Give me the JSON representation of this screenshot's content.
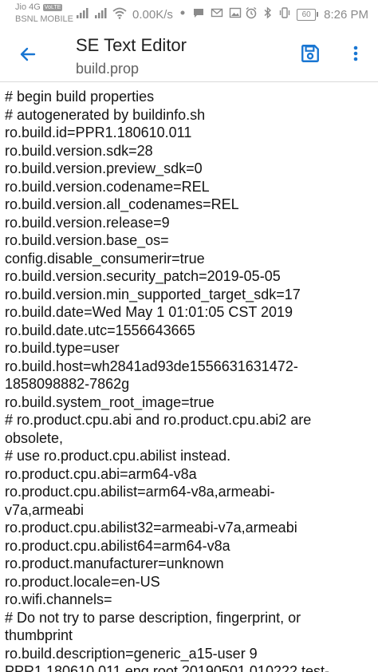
{
  "status_bar": {
    "carrier_top": "Jio 4G",
    "volte_badge": "VoLTE",
    "carrier_bottom": "BSNL MOBILE",
    "net_speed": "0.00K/s",
    "battery_level": "60",
    "time": "8:26 PM",
    "icon_color": "#8a8a8a"
  },
  "app_bar": {
    "title": "SE Text Editor",
    "subtitle": "build.prop",
    "accent_color": "#1976d2",
    "back_icon": "arrow-back-icon",
    "save_icon": "save-icon",
    "more_icon": "more-vert-icon"
  },
  "editor": {
    "lines": [
      "# begin build properties",
      "# autogenerated by buildinfo.sh",
      "ro.build.id=PPR1.180610.011",
      "ro.build.version.sdk=28",
      "ro.build.version.preview_sdk=0",
      "ro.build.version.codename=REL",
      "ro.build.version.all_codenames=REL",
      "ro.build.version.release=9",
      "ro.build.version.base_os=",
      "config.disable_consumerir=true",
      "ro.build.version.security_patch=2019-05-05",
      "ro.build.version.min_supported_target_sdk=17",
      "ro.build.date=Wed May  1 01:01:05 CST 2019",
      "ro.build.date.utc=1556643665",
      "ro.build.type=user",
      "ro.build.host=wh2841ad93de1556631631472-",
      "1858098882-7862g",
      "ro.build.system_root_image=true",
      "# ro.product.cpu.abi and ro.product.cpu.abi2 are",
      "obsolete,",
      "# use ro.product.cpu.abilist instead.",
      "ro.product.cpu.abi=arm64-v8a",
      "ro.product.cpu.abilist=arm64-v8a,armeabi-",
      "v7a,armeabi",
      "ro.product.cpu.abilist32=armeabi-v7a,armeabi",
      "ro.product.cpu.abilist64=arm64-v8a",
      "ro.product.manufacturer=unknown",
      "ro.product.locale=en-US",
      "ro.wifi.channels=",
      "# Do not try to parse description, fingerprint, or",
      "thumbprint",
      "ro.build.description=generic_a15-user 9",
      "PPR1.180610.011 eng.root.20190501.010222 test-"
    ]
  }
}
